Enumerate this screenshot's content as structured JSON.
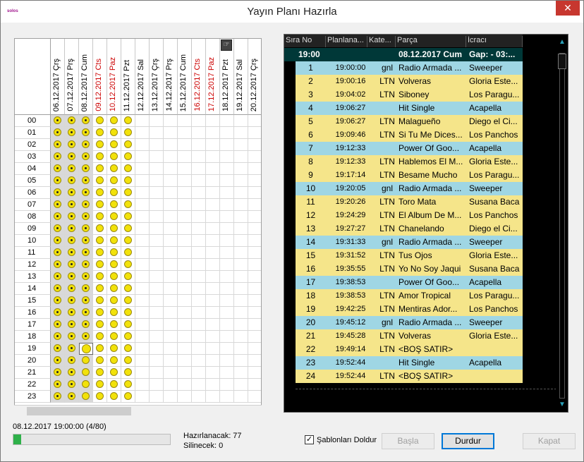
{
  "window": {
    "title": "Yayın Planı Hazırla",
    "app_icon_text": "solos",
    "close_symbol": "✕"
  },
  "colors": {
    "dot": "#f2e20a",
    "sweeper_row": "#9fd6e4",
    "song_row": "#f5e58a",
    "current_row": "#003838",
    "weekend": "#cc0000",
    "progress": "#2fb14a"
  },
  "grid": {
    "columns": [
      {
        "label": "06.12.2017 Çrş",
        "weekend": false
      },
      {
        "label": "07.12.2017 Prş",
        "weekend": false
      },
      {
        "label": "08.12.2017 Cum",
        "weekend": false
      },
      {
        "label": "09.12.2017 Cts",
        "weekend": true
      },
      {
        "label": "10.12.2017 Paz",
        "weekend": true
      },
      {
        "label": "11.12.2017 Pzt",
        "weekend": false
      },
      {
        "label": "12.12.2017 Sal",
        "weekend": false
      },
      {
        "label": "13.12.2017 Çrş",
        "weekend": false
      },
      {
        "label": "14.12.2017 Prş",
        "weekend": false
      },
      {
        "label": "15.12.2017 Cum",
        "weekend": false
      },
      {
        "label": "16.12.2017 Cts",
        "weekend": true
      },
      {
        "label": "17.12.2017 Paz",
        "weekend": true
      },
      {
        "label": "18.12.2017 Pzt",
        "weekend": false
      },
      {
        "label": "19.12.2017 Sal",
        "weekend": false
      },
      {
        "label": "20.12.2017 Çrş",
        "weekend": false
      }
    ],
    "hours": [
      "00",
      "01",
      "02",
      "03",
      "04",
      "05",
      "06",
      "07",
      "08",
      "09",
      "10",
      "11",
      "12",
      "13",
      "14",
      "15",
      "16",
      "17",
      "18",
      "19",
      "20",
      "21",
      "22",
      "23"
    ],
    "filled_columns": 6,
    "done_through": {
      "0": 23,
      "1": 23,
      "2": 18
    },
    "current": {
      "col": 2,
      "row": 19
    }
  },
  "playlist": {
    "headers": [
      "Sıra No",
      "Planlana...",
      "Kate...",
      "Parça",
      "İcracı"
    ],
    "current_row": {
      "time": "19:00",
      "date": "08.12.2017 Cum",
      "gap": "Gap:  - 03:..."
    },
    "rows": [
      {
        "no": "1",
        "time": "19:00:00",
        "kat": "gnl",
        "parca": "Radio Armada ...",
        "icraci": "Sweeper",
        "type": "sweeper"
      },
      {
        "no": "2",
        "time": "19:00:16",
        "kat": "LTN",
        "parca": "Volveras",
        "icraci": "Gloria Este...",
        "type": "song"
      },
      {
        "no": "3",
        "time": "19:04:02",
        "kat": "LTN",
        "parca": "Siboney",
        "icraci": "Los Paragu...",
        "type": "song"
      },
      {
        "no": "4",
        "time": "19:06:27",
        "kat": "",
        "parca": "Hit Single",
        "icraci": "Acapella",
        "type": "sweeper"
      },
      {
        "no": "5",
        "time": "19:06:27",
        "kat": "LTN",
        "parca": "Malagueño",
        "icraci": "Diego el Ci...",
        "type": "song"
      },
      {
        "no": "6",
        "time": "19:09:46",
        "kat": "LTN",
        "parca": "Si Tu Me Dices...",
        "icraci": "Los Panchos",
        "type": "song"
      },
      {
        "no": "7",
        "time": "19:12:33",
        "kat": "",
        "parca": "Power Of Goo...",
        "icraci": "Acapella",
        "type": "sweeper"
      },
      {
        "no": "8",
        "time": "19:12:33",
        "kat": "LTN",
        "parca": "Hablemos El M...",
        "icraci": "Gloria Este...",
        "type": "song"
      },
      {
        "no": "9",
        "time": "19:17:14",
        "kat": "LTN",
        "parca": "Besame Mucho",
        "icraci": "Los Paragu...",
        "type": "song"
      },
      {
        "no": "10",
        "time": "19:20:05",
        "kat": "gnl",
        "parca": "Radio Armada ...",
        "icraci": "Sweeper",
        "type": "sweeper"
      },
      {
        "no": "11",
        "time": "19:20:26",
        "kat": "LTN",
        "parca": "Toro Mata",
        "icraci": "Susana Baca",
        "type": "song"
      },
      {
        "no": "12",
        "time": "19:24:29",
        "kat": "LTN",
        "parca": "El Album De M...",
        "icraci": "Los Panchos",
        "type": "song"
      },
      {
        "no": "13",
        "time": "19:27:27",
        "kat": "LTN",
        "parca": "Chanelando",
        "icraci": "Diego el Ci...",
        "type": "song"
      },
      {
        "no": "14",
        "time": "19:31:33",
        "kat": "gnl",
        "parca": "Radio Armada ...",
        "icraci": "Sweeper",
        "type": "sweeper"
      },
      {
        "no": "15",
        "time": "19:31:52",
        "kat": "LTN",
        "parca": "Tus Ojos",
        "icraci": "Gloria Este...",
        "type": "song"
      },
      {
        "no": "16",
        "time": "19:35:55",
        "kat": "LTN",
        "parca": "Yo No Soy Jaqui",
        "icraci": "Susana Baca",
        "type": "song"
      },
      {
        "no": "17",
        "time": "19:38:53",
        "kat": "",
        "parca": "Power Of Goo...",
        "icraci": "Acapella",
        "type": "sweeper"
      },
      {
        "no": "18",
        "time": "19:38:53",
        "kat": "LTN",
        "parca": "Amor Tropical",
        "icraci": "Los Paragu...",
        "type": "song"
      },
      {
        "no": "19",
        "time": "19:42:25",
        "kat": "LTN",
        "parca": "Mentiras Ador...",
        "icraci": "Los Panchos",
        "type": "song"
      },
      {
        "no": "20",
        "time": "19:45:12",
        "kat": "gnl",
        "parca": "Radio Armada ...",
        "icraci": "Sweeper",
        "type": "sweeper"
      },
      {
        "no": "21",
        "time": "19:45:28",
        "kat": "LTN",
        "parca": "Volveras",
        "icraci": "Gloria Este...",
        "type": "song"
      },
      {
        "no": "22",
        "time": "19:49:14",
        "kat": "LTN",
        "parca": "<BOŞ SATIR>",
        "icraci": "",
        "type": "song"
      },
      {
        "no": "23",
        "time": "19:52:44",
        "kat": "",
        "parca": "Hit Single",
        "icraci": "Acapella",
        "type": "sweeper"
      },
      {
        "no": "24",
        "time": "19:52:44",
        "kat": "LTN",
        "parca": "<BOŞ SATIR>",
        "icraci": "",
        "type": "song"
      }
    ]
  },
  "status": {
    "text": "08.12.2017 19:00:00    (4/80)",
    "progress_fraction": 0.05,
    "hazirlanacak": "Hazırlanacak:  77",
    "silinecek": "Silinecek:  0"
  },
  "controls": {
    "checkbox_label": "Şablonları Doldur",
    "checkbox_checked": "✓",
    "basla": "Başla",
    "durdur": "Durdur",
    "kapat": "Kapat"
  }
}
